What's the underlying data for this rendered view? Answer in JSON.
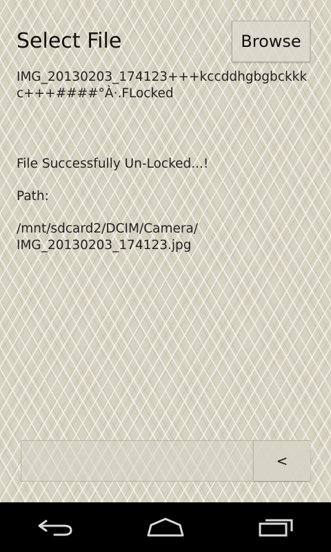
{
  "header": {
    "title": "Select File",
    "browse_label": "Browse"
  },
  "content": {
    "file_name": "IMG_20130203_174123+++kccddhgbgbckkk\nc+++####°À·.FLocked",
    "status": "File Successfully Un-Locked...!",
    "path_label": "Path:",
    "path_value": "/mnt/sdcard2/DCIM/Camera/\nIMG_20130203_174123.jpg"
  },
  "bottom": {
    "input_value": "",
    "back_label": "<"
  },
  "navbar": {
    "icons": [
      "back-icon",
      "home-icon",
      "recent-apps-icon"
    ]
  }
}
